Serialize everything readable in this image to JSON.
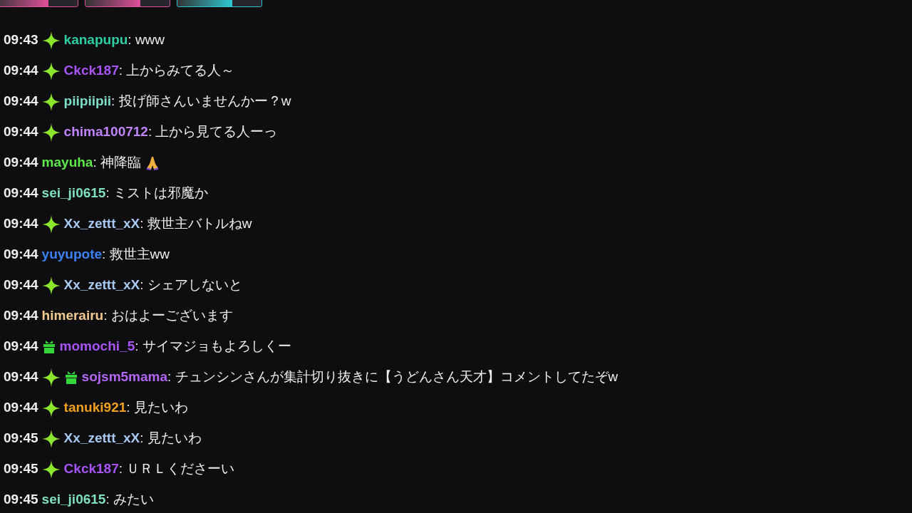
{
  "top_cards": [
    {
      "color": "#e0509a"
    },
    {
      "color": "#e0509a"
    },
    {
      "color": "#2ec8d0"
    }
  ],
  "messages": [
    {
      "time": "09:43",
      "badges": [
        {
          "kind": "sparkle"
        }
      ],
      "user": "kanapupu",
      "color": "#2fd0a0",
      "text": ": www"
    },
    {
      "time": "09:44",
      "badges": [
        {
          "kind": "sparkle"
        }
      ],
      "user": "Ckck187",
      "color": "#a855f7",
      "text": ": 上からみてる人～"
    },
    {
      "time": "09:44",
      "badges": [
        {
          "kind": "sparkle"
        }
      ],
      "user": "piipiipii",
      "color": "#7fe0c8",
      "text": ": 投げ師さんいませんかー？w"
    },
    {
      "time": "09:44",
      "badges": [
        {
          "kind": "sparkle"
        }
      ],
      "user": "chima100712",
      "color": "#c084fc",
      "text": ": 上から見てる人ーっ"
    },
    {
      "time": "09:44",
      "user": "mayuha",
      "color": "#5ee84a",
      "text": ": 神降臨",
      "emote": true
    },
    {
      "time": "09:44",
      "user": "sei_ji0615",
      "color": "#7ee0c0",
      "text": ": ミストは邪魔か"
    },
    {
      "time": "09:44",
      "badges": [
        {
          "kind": "sparkle"
        }
      ],
      "user": "Xx_zettt_xX",
      "color": "#a8c8f0",
      "text": ": 救世主バトルねw"
    },
    {
      "time": "09:44",
      "user": "yuyupote",
      "color": "#3b82f6",
      "text": ": 救世主ww"
    },
    {
      "time": "09:44",
      "badges": [
        {
          "kind": "sparkle"
        }
      ],
      "user": "Xx_zettt_xX",
      "color": "#a8c8f0",
      "text": ": シェアしないと"
    },
    {
      "time": "09:44",
      "user": "himerairu",
      "color": "#f0c890",
      "text": ": おはよーございます"
    },
    {
      "time": "09:44",
      "badges": [
        {
          "kind": "gift"
        }
      ],
      "user": "momochi_5",
      "color": "#a855f7",
      "text": ": サイマジョもよろしくー"
    },
    {
      "time": "09:44",
      "badges": [
        {
          "kind": "sparkle"
        },
        {
          "kind": "gift"
        }
      ],
      "user": "sojsm5mama",
      "color": "#b266f5",
      "text": ": チュンシンさんが集計切り抜きに【うどんさん天才】コメントしてたぞw"
    },
    {
      "time": "09:44",
      "badges": [
        {
          "kind": "sparkle"
        }
      ],
      "user": "tanuki921",
      "color": "#f0a020",
      "text": ": 見たいわ"
    },
    {
      "time": "09:45",
      "badges": [
        {
          "kind": "sparkle"
        }
      ],
      "user": "Xx_zettt_xX",
      "color": "#a8c8f0",
      "text": ": 見たいわ"
    },
    {
      "time": "09:45",
      "badges": [
        {
          "kind": "sparkle"
        }
      ],
      "user": "Ckck187",
      "color": "#a855f7",
      "text": ": ＵＲＬくださーい"
    },
    {
      "time": "09:45",
      "user": "sei_ji0615",
      "color": "#7ee0c0",
      "text": ": みたい"
    }
  ]
}
